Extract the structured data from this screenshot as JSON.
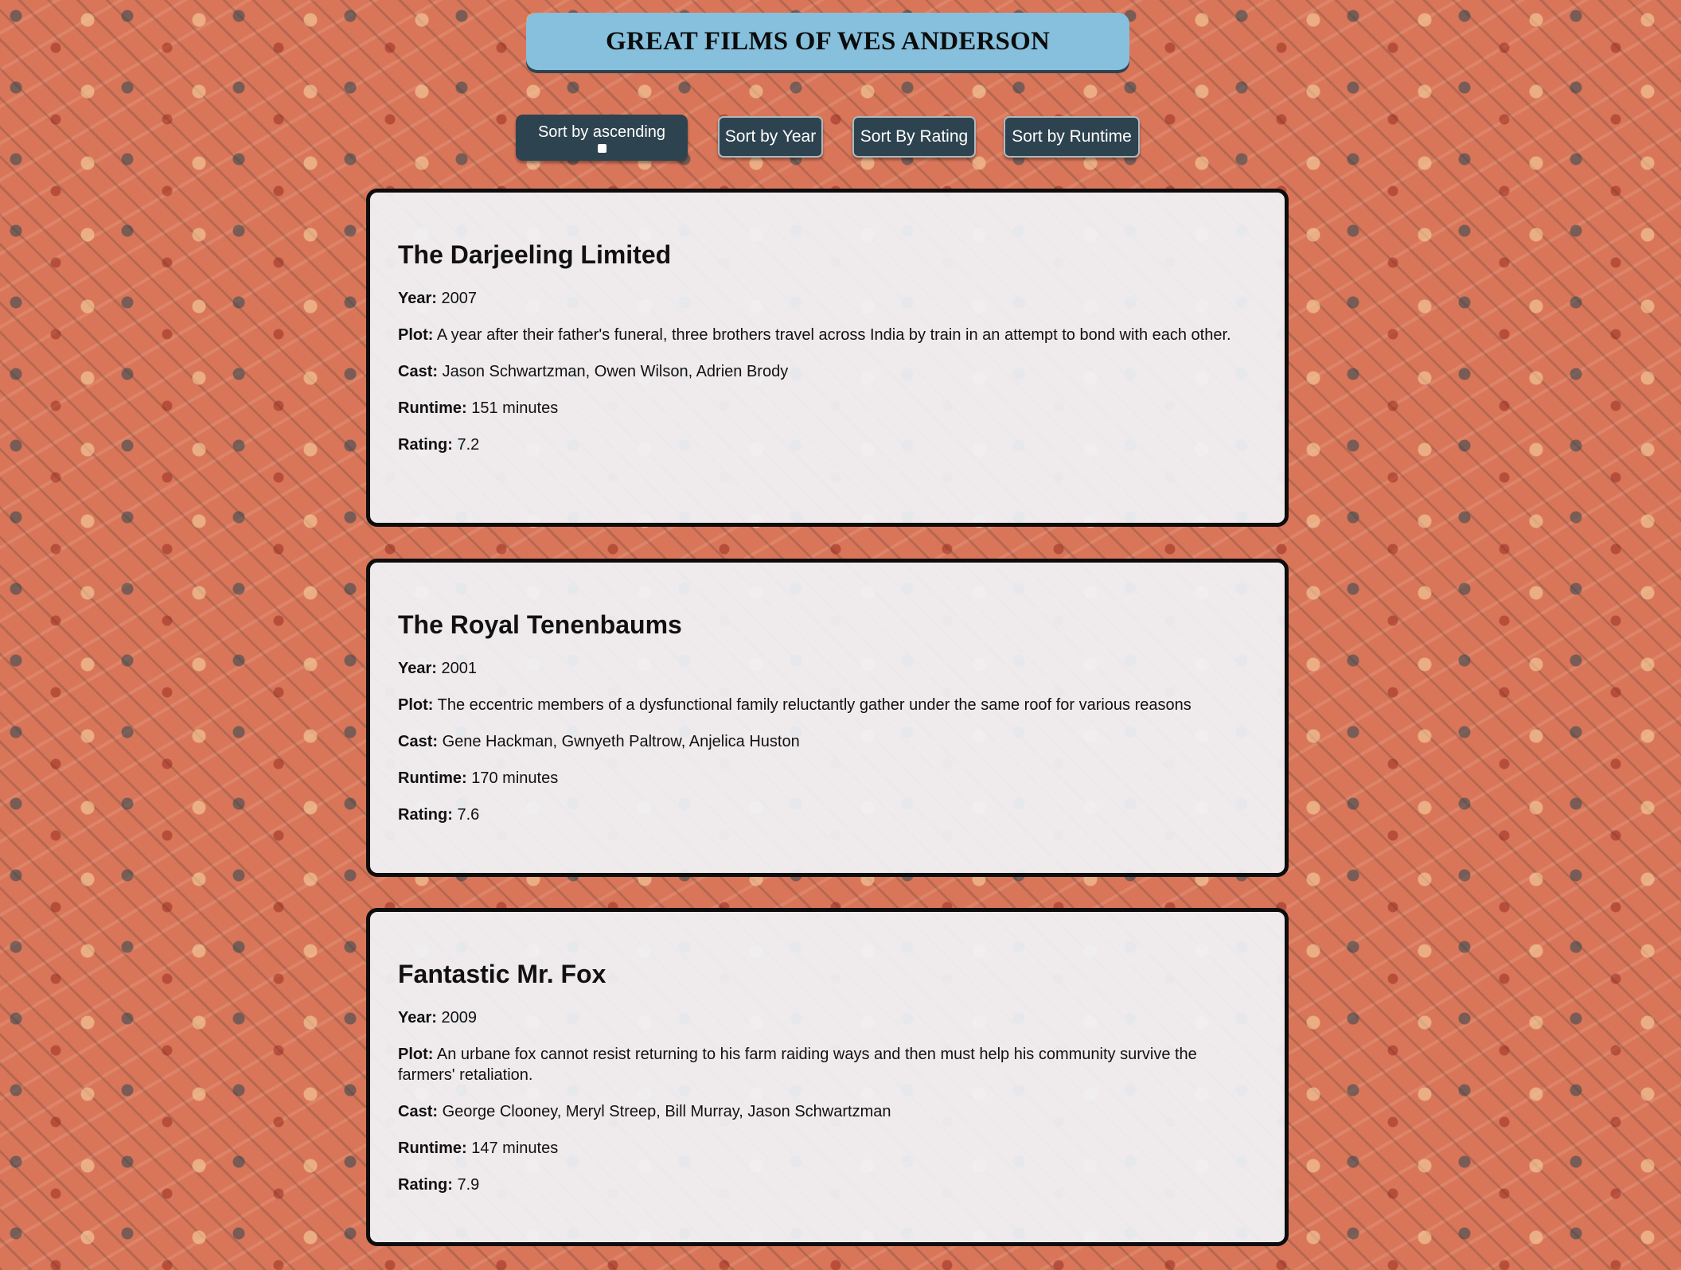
{
  "header": {
    "title": "GREAT FILMS OF WES ANDERSON"
  },
  "sort_controls": {
    "ascending_label": "Sort by ascending",
    "ascending_checked": false,
    "year_label": "Sort by Year",
    "rating_label": "Sort By Rating",
    "runtime_label": "Sort by Runtime"
  },
  "labels": {
    "year": "Year:",
    "plot": "Plot:",
    "cast": "Cast:",
    "runtime": "Runtime:",
    "rating": "Rating:"
  },
  "films": [
    {
      "title": "The Darjeeling Limited",
      "year": "2007",
      "plot": "A year after their father's funeral, three brothers travel across India by train in an attempt to bond with each other.",
      "cast": "Jason Schwartzman, Owen Wilson, Adrien Brody",
      "runtime": "151 minutes",
      "rating": "7.2"
    },
    {
      "title": "The Royal Tenenbaums",
      "year": "2001",
      "plot": "The eccentric members of a dysfunctional family reluctantly gather under the same roof for various reasons",
      "cast": "Gene Hackman, Gwnyeth Paltrow, Anjelica Huston",
      "runtime": "170 minutes",
      "rating": "7.6"
    },
    {
      "title": "Fantastic Mr. Fox",
      "year": "2009",
      "plot": "An urbane fox cannot resist returning to his farm raiding ways and then must help his community survive the farmers' retaliation.",
      "cast": "George Clooney, Meryl Streep, Bill Murray, Jason Schwartzman",
      "runtime": "147 minutes",
      "rating": "7.9"
    }
  ]
}
